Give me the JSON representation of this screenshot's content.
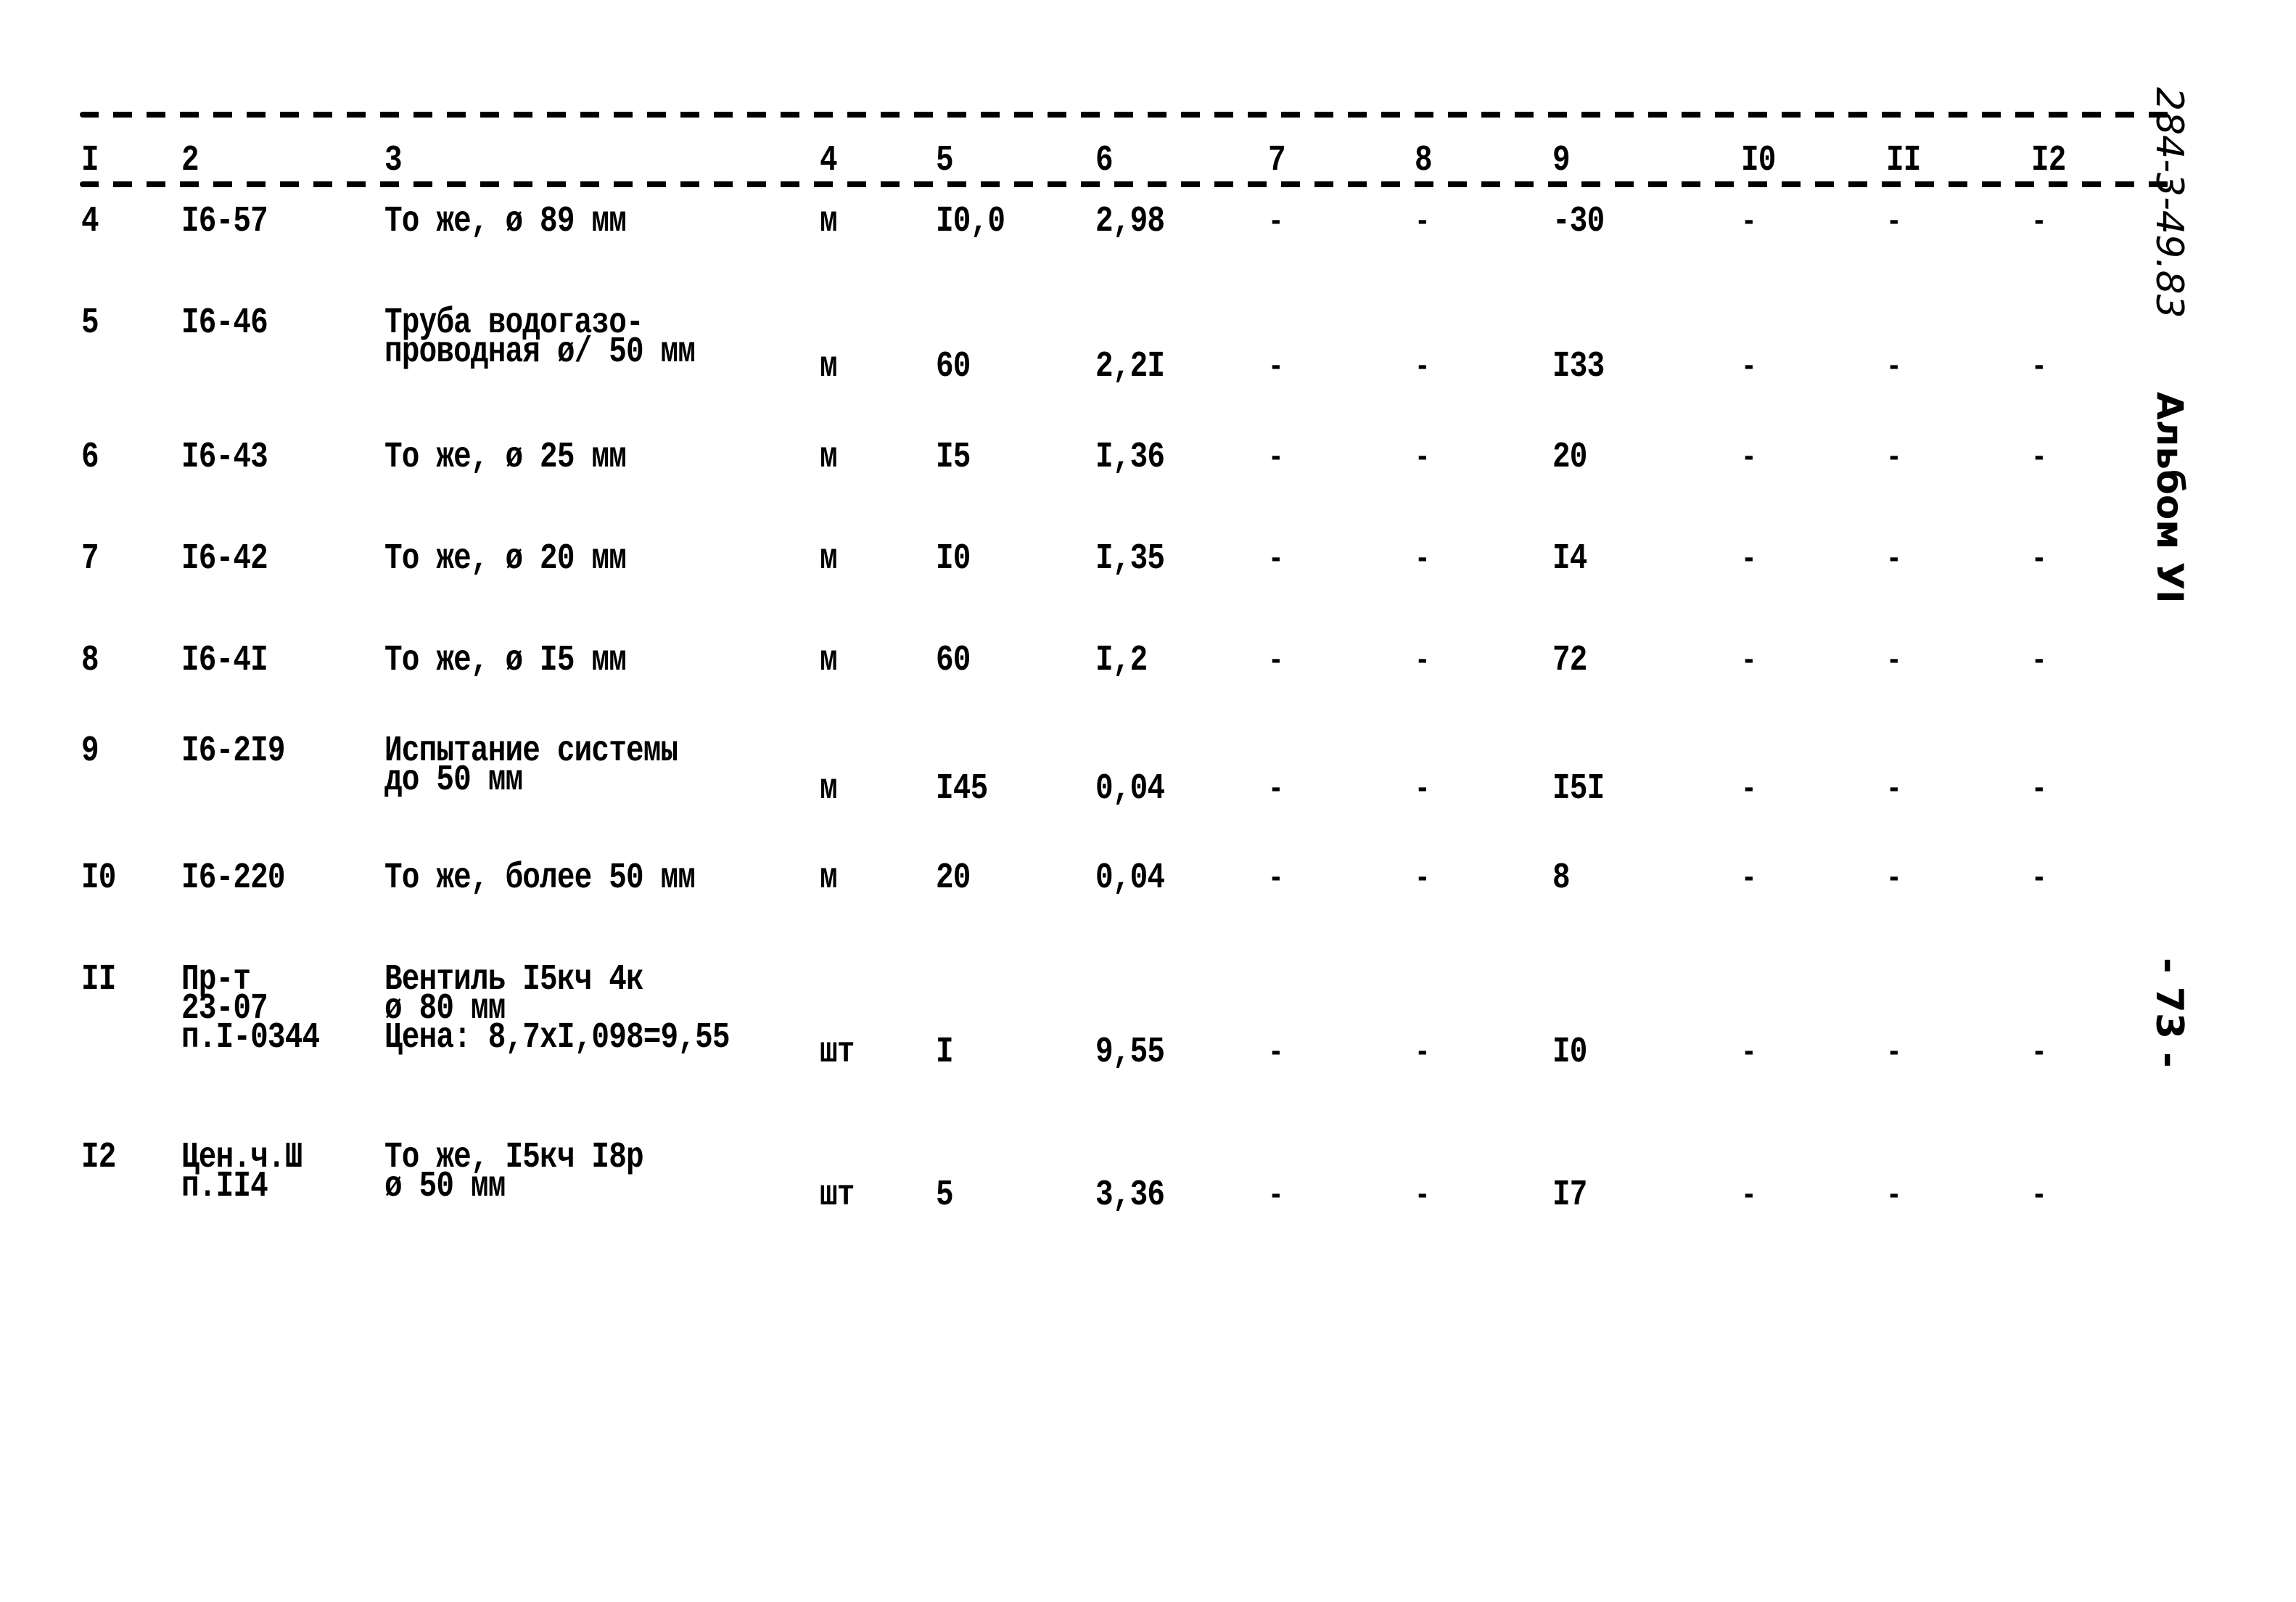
{
  "document": {
    "side_code": "284-3-49.83",
    "side_album": "Альбом УI",
    "page_number": "- 73 -"
  },
  "table": {
    "headers": [
      "I",
      "2",
      "3",
      "4",
      "5",
      "6",
      "7",
      "8",
      "9",
      "I0",
      "II",
      "I2"
    ],
    "rows": [
      {
        "n": "4",
        "code": [
          "I6-57"
        ],
        "desc": [
          "То же, ø 89 мм"
        ],
        "unit": "м",
        "qty": "I0,0",
        "price": "2,98",
        "c7": "-",
        "c8": "-",
        "c9": "-30",
        "c10": "-",
        "c11": "-",
        "c12": "-"
      },
      {
        "n": "5",
        "code": [
          "I6-46"
        ],
        "desc": [
          "Труба водогазо-",
          "проводная ø/ 50 мм"
        ],
        "unit": "м",
        "qty": "60",
        "price": "2,2I",
        "c7": "-",
        "c8": "-",
        "c9": "I33",
        "c10": "-",
        "c11": "-",
        "c12": "-"
      },
      {
        "n": "6",
        "code": [
          "I6-43"
        ],
        "desc": [
          "То же, ø 25 мм"
        ],
        "unit": "м",
        "qty": "I5",
        "price": "I,36",
        "c7": "-",
        "c8": "-",
        "c9": "20",
        "c10": "-",
        "c11": "-",
        "c12": "-"
      },
      {
        "n": "7",
        "code": [
          "I6-42"
        ],
        "desc": [
          "То же, ø 20 мм"
        ],
        "unit": "м",
        "qty": "I0",
        "price": "I,35",
        "c7": "-",
        "c8": "-",
        "c9": "I4",
        "c10": "-",
        "c11": "-",
        "c12": "-"
      },
      {
        "n": "8",
        "code": [
          "I6-4I"
        ],
        "desc": [
          "То же, ø I5 мм"
        ],
        "unit": "м",
        "qty": "60",
        "price": "I,2",
        "c7": "-",
        "c8": "-",
        "c9": "72",
        "c10": "-",
        "c11": "-",
        "c12": "-"
      },
      {
        "n": "9",
        "code": [
          "I6-2I9"
        ],
        "desc": [
          "Испытание системы",
          "до 50 мм"
        ],
        "unit": "м",
        "qty": "I45",
        "price": "0,04",
        "c7": "-",
        "c8": "-",
        "c9": "I5I",
        "c10": "-",
        "c11": "-",
        "c12": "-"
      },
      {
        "n": "I0",
        "code": [
          "I6-220"
        ],
        "desc": [
          "То же, более 50 мм"
        ],
        "unit": "м",
        "qty": "20",
        "price": "0,04",
        "c7": "-",
        "c8": "-",
        "c9": "8",
        "c10": "-",
        "c11": "-",
        "c12": "-"
      },
      {
        "n": "II",
        "code": [
          "Пр-т",
          "23-07",
          "п.I-0344"
        ],
        "desc": [
          "Вентиль I5кч 4к",
          "ø 80 мм",
          "Цена: 8,7хI,098=9,55"
        ],
        "unit": "шт",
        "qty": "I",
        "price": "9,55",
        "c7": "-",
        "c8": "-",
        "c9": "I0",
        "c10": "-",
        "c11": "-",
        "c12": "-"
      },
      {
        "n": "I2",
        "code": [
          "Цен.ч.Ш",
          "п.II4"
        ],
        "desc": [
          "То же, I5кч I8р",
          "ø 50 мм"
        ],
        "unit": "шт",
        "qty": "5",
        "price": "3,36",
        "c7": "-",
        "c8": "-",
        "c9": "I7",
        "c10": "-",
        "c11": "-",
        "c12": "-"
      }
    ]
  }
}
